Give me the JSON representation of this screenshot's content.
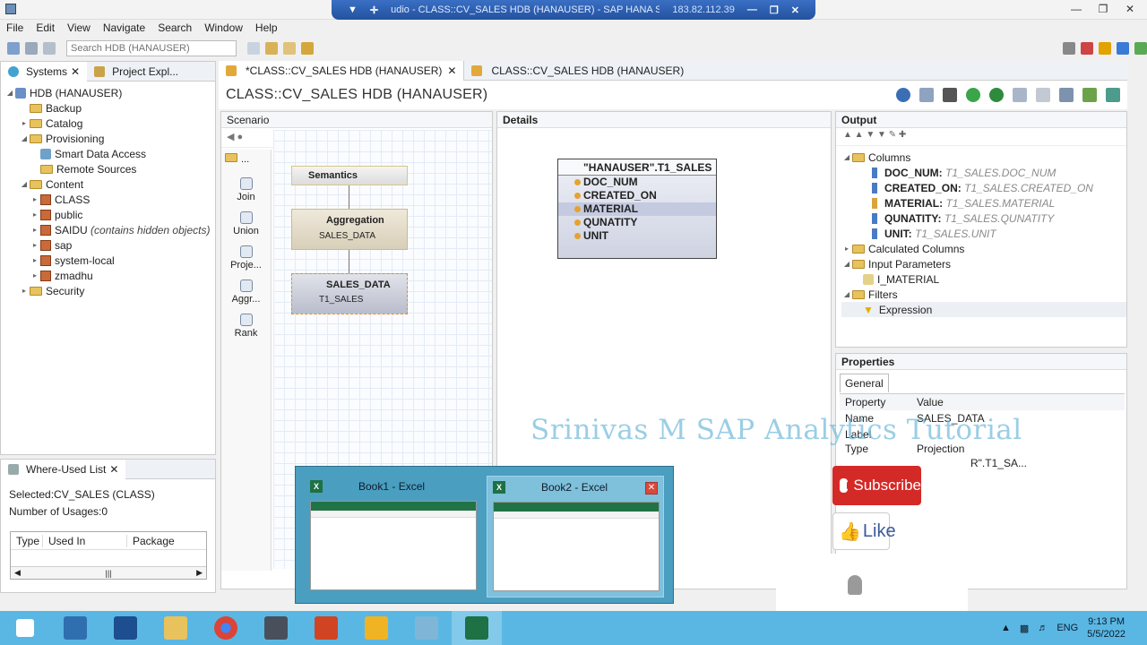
{
  "rdp": {
    "title": "udio - CLASS::CV_SALES HDB (HANAUSER) - SAP HANA S",
    "ip": "183.82.112.39"
  },
  "menu": [
    "File",
    "Edit",
    "View",
    "Navigate",
    "Search",
    "Window",
    "Help"
  ],
  "toolbar": {
    "search_placeholder": "Search HDB (HANAUSER)"
  },
  "left": {
    "tab_systems": "Systems",
    "tab_project": "Project Expl...",
    "tree": {
      "root": "HDB (HANAUSER)",
      "backup": "Backup",
      "catalog": "Catalog",
      "provisioning": "Provisioning",
      "smart": "Smart Data Access",
      "remote": "Remote Sources",
      "content": "Content",
      "class": "CLASS",
      "public": "public",
      "saidu": "SAIDU",
      "saidu_note": "(contains hidden objects)",
      "sap": "sap",
      "system_local": "system-local",
      "zmadhu": "zmadhu",
      "security": "Security"
    }
  },
  "where": {
    "title": "Where-Used List",
    "selected": "Selected:CV_SALES  (CLASS)",
    "usages": "Number of Usages:0",
    "cols": [
      "Type",
      "Used In",
      "Package"
    ]
  },
  "editor": {
    "tab_active": "*CLASS::CV_SALES HDB (HANAUSER)",
    "tab_other": "CLASS::CV_SALES HDB (HANAUSER)",
    "title": "CLASS::CV_SALES HDB (HANAUSER)"
  },
  "scenario": {
    "title": "Scenario",
    "palette_head": "...",
    "palette": [
      "Join",
      "Union",
      "Proje...",
      "Aggr...",
      "Rank"
    ],
    "semantics": "Semantics",
    "aggregation": "Aggregation",
    "agg_sub": "SALES_DATA",
    "sales_data": "SALES_DATA",
    "sd_sub": "T1_SALES"
  },
  "details": {
    "title": "Details",
    "table_name": "\"HANAUSER\".T1_SALES",
    "columns": [
      "DOC_NUM",
      "CREATED_ON",
      "MATERIAL",
      "QUNATITY",
      "UNIT"
    ]
  },
  "output": {
    "title": "Output",
    "columns_folder": "Columns",
    "cols": [
      {
        "name": "DOC_NUM:",
        "src": "T1_SALES.DOC_NUM"
      },
      {
        "name": "CREATED_ON:",
        "src": "T1_SALES.CREATED_ON"
      },
      {
        "name": "MATERIAL:",
        "src": "T1_SALES.MATERIAL"
      },
      {
        "name": "QUNATITY:",
        "src": "T1_SALES.QUNATITY"
      },
      {
        "name": "UNIT:",
        "src": "T1_SALES.UNIT"
      }
    ],
    "calc": "Calculated Columns",
    "input": "Input Parameters",
    "input_item": "I_MATERIAL",
    "filters": "Filters",
    "expression": "Expression"
  },
  "properties": {
    "title": "Properties",
    "tab": "General",
    "col_property": "Property",
    "col_value": "Value",
    "name_key": "Name",
    "name_val": "SALES_DATA",
    "label_key": "Label",
    "type_key": "Type",
    "type_val": "Projection",
    "data_val": "R\".T1_SA..."
  },
  "watermark": "Srinivas M SAP Analytics Tutorial",
  "thumbs": {
    "book1": "Book1 - Excel",
    "book2": "Book2 - Excel"
  },
  "overlay": {
    "subscribe": "Subscribe",
    "like": "Like"
  },
  "tray": {
    "lang": "ENG",
    "time": "9:13 PM",
    "date": "5/5/2022"
  }
}
